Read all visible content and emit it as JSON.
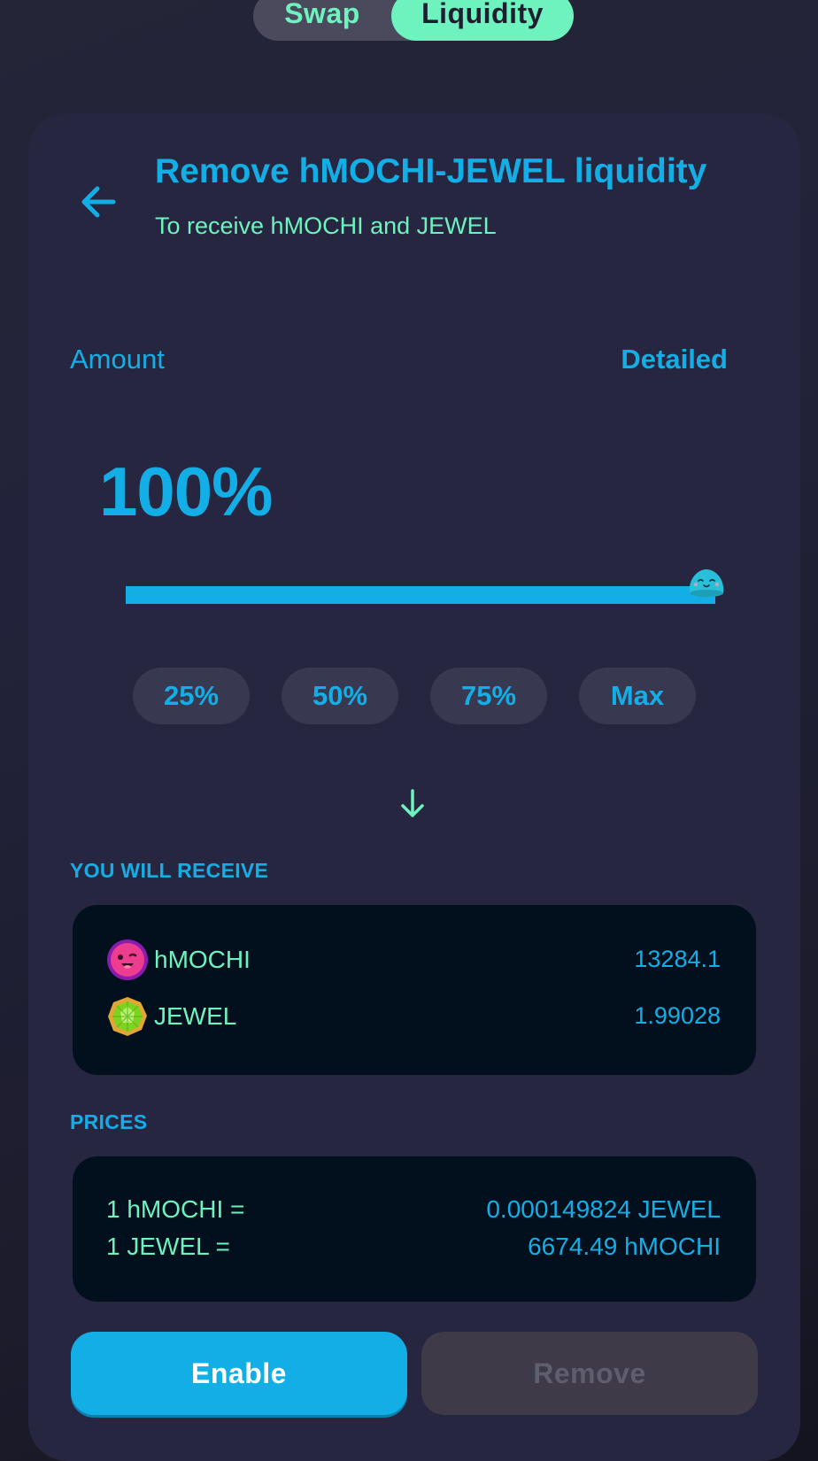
{
  "mode_toggle": {
    "tabs": [
      {
        "label": "Swap",
        "active": false
      },
      {
        "label": "Liquidity",
        "active": true
      }
    ]
  },
  "header": {
    "title": "Remove hMOCHI-JEWEL liquidity",
    "subtitle": "To receive hMOCHI and JEWEL"
  },
  "amount": {
    "label": "Amount",
    "mode_link": "Detailed",
    "percent_text": "100%",
    "slider_level_percent": 100
  },
  "presets": [
    "25%",
    "50%",
    "75%",
    "Max"
  ],
  "receive": {
    "label": "YOU WILL RECEIVE",
    "tokens": [
      {
        "symbol": "hMOCHI",
        "amount": "13284.1",
        "icon": "hmochi-token-icon"
      },
      {
        "symbol": "JEWEL",
        "amount": "1.99028",
        "icon": "jewel-token-icon"
      }
    ]
  },
  "prices": {
    "label": "PRICES",
    "rows": [
      {
        "label": "1 hMOCHI =",
        "value": "0.000149824 JEWEL"
      },
      {
        "label": "1 JEWEL =",
        "value": "6674.49 hMOCHI"
      }
    ]
  },
  "actions": {
    "enable_label": "Enable",
    "remove_label": "Remove",
    "remove_disabled": true
  },
  "colors": {
    "accent_blue": "#14aee6",
    "accent_green": "#6ef2be",
    "card_background": "#262640",
    "panel_background": "#02101e"
  }
}
